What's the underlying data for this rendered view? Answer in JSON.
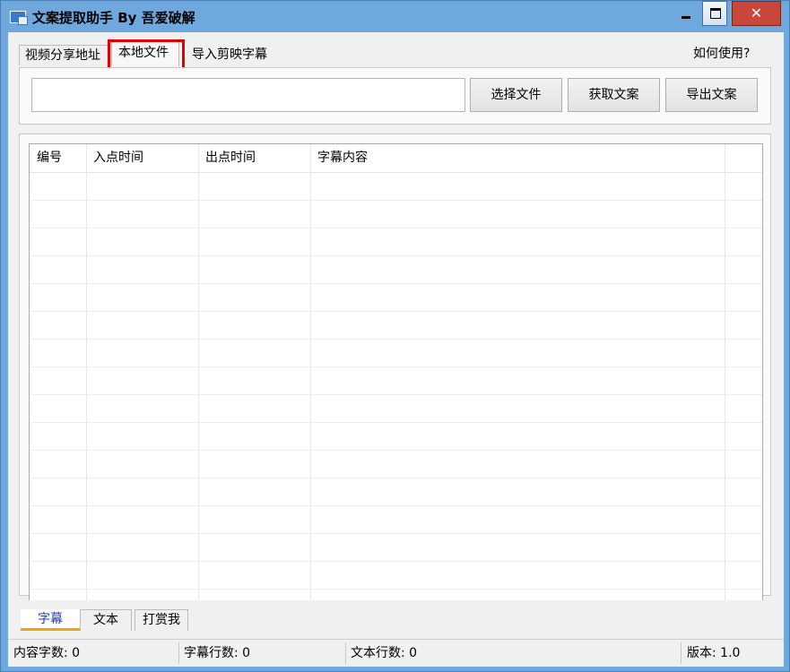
{
  "window": {
    "title": "文案提取助手 By 吾爱破解",
    "close_glyph": "✕"
  },
  "top_tabs": {
    "video": "视频分享地址",
    "local": "本地文件",
    "jianying": "导入剪映字幕",
    "help": "如何使用?"
  },
  "file_panel": {
    "path_value": "",
    "select_label": "选择文件",
    "fetch_label": "获取文案",
    "export_label": "导出文案"
  },
  "table": {
    "columns": [
      "编号",
      "入点时间",
      "出点时间",
      "字幕内容"
    ],
    "rows": []
  },
  "bottom_tabs": {
    "subtitles": "字幕",
    "text": "文本",
    "reward": "打赏我"
  },
  "status": {
    "content_chars": "内容字数: 0",
    "subtitle_lines": "字幕行数: 0",
    "text_lines": "文本行数: 0",
    "version": "版本: 1.0"
  },
  "colors": {
    "title_bar": "#6fa8dc",
    "close_button": "#c7473b",
    "highlight_box": "#e00000",
    "active_tab_underline": "#f0a30a"
  }
}
